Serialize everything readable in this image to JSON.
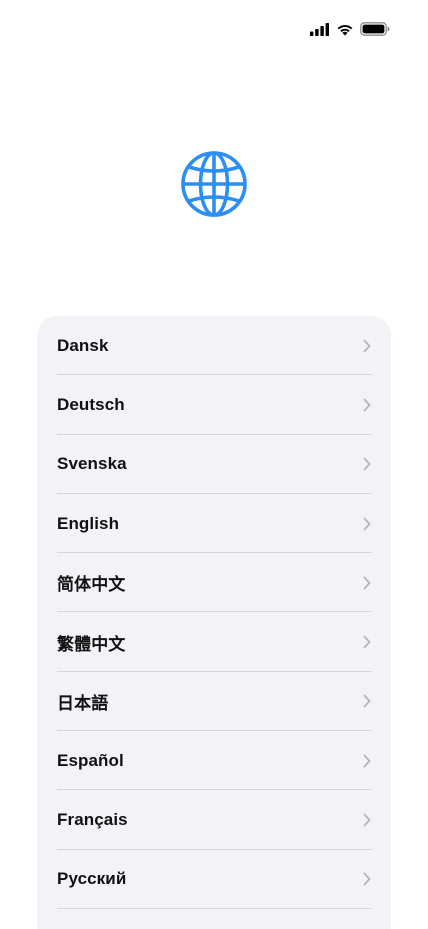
{
  "status_bar": {
    "icons": [
      "cellular-signal-icon",
      "wifi-icon",
      "battery-icon"
    ]
  },
  "header": {
    "icon": "globe-icon",
    "accent_color": "#2b8ef0"
  },
  "languages": [
    {
      "label": "Dansk"
    },
    {
      "label": "Deutsch"
    },
    {
      "label": "Svenska"
    },
    {
      "label": "English"
    },
    {
      "label": "简体中文"
    },
    {
      "label": "繁體中文"
    },
    {
      "label": "日本語"
    },
    {
      "label": "Español"
    },
    {
      "label": "Français"
    },
    {
      "label": "Русский"
    }
  ]
}
